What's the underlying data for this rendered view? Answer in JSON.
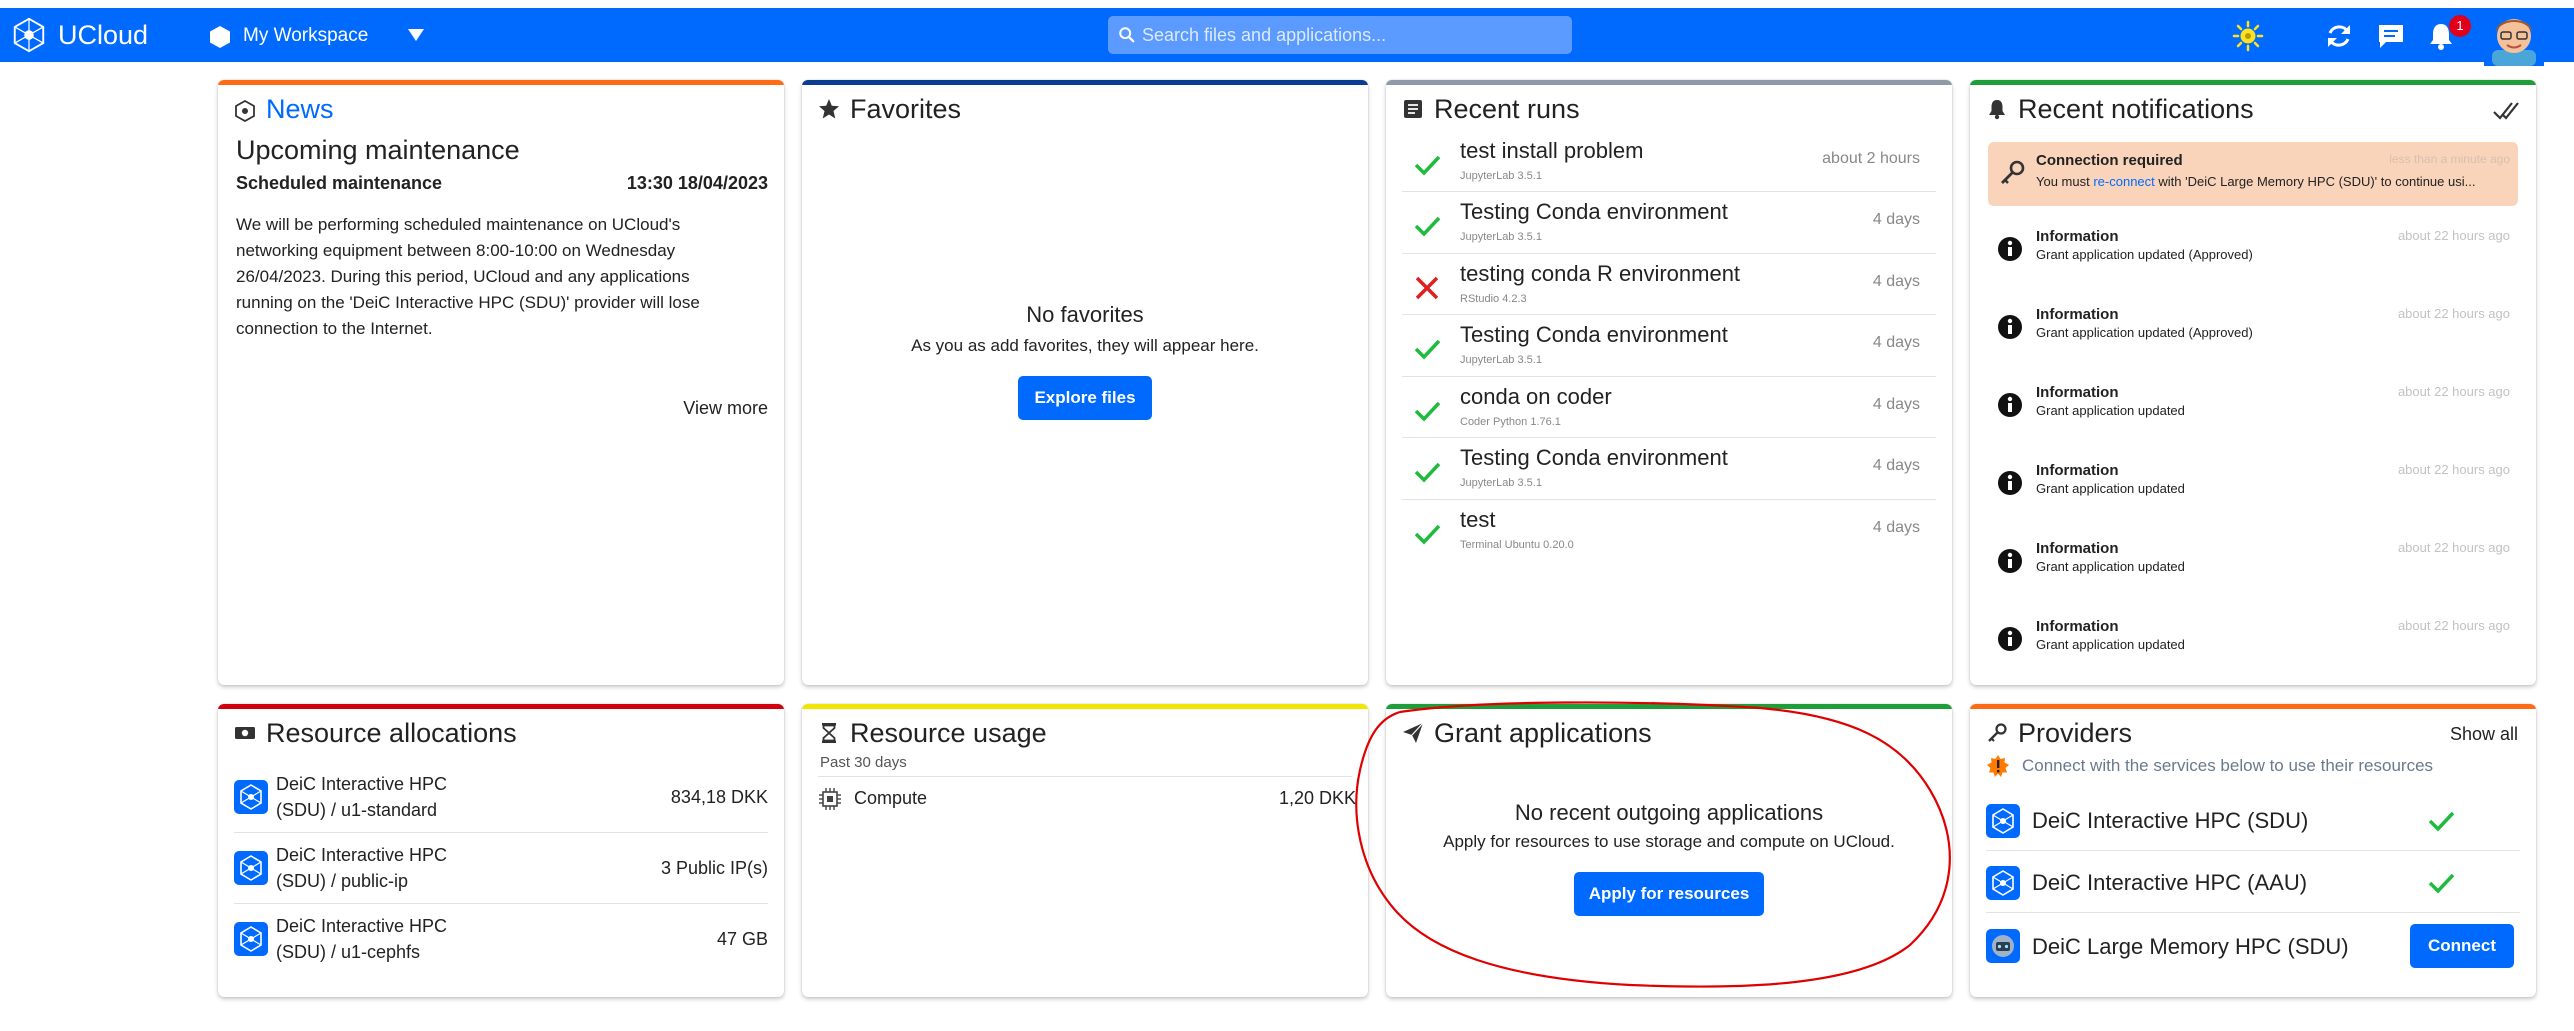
{
  "navbar": {
    "brand": "UCloud",
    "workspace": "My Workspace",
    "search_placeholder": "Search files and applications...",
    "notification_count": "1"
  },
  "news": {
    "title": "News",
    "headline": "Upcoming maintenance",
    "subheading": "Scheduled maintenance",
    "datetime": "13:30 18/04/2023",
    "body_lines": [
      "We will be performing scheduled maintenance on UCloud's",
      "networking equipment between 8:00-10:00 on Wednesday",
      "26/04/2023. During this period, UCloud and any applications",
      "running on the 'DeiC Interactive HPC (SDU)' provider will lose",
      "connection to the Internet."
    ],
    "view_more": "View more"
  },
  "favorites": {
    "title": "Favorites",
    "empty_title": "No favorites",
    "empty_text": "As you as add favorites, they will appear here.",
    "button": "Explore files"
  },
  "recent_runs": {
    "title": "Recent runs",
    "items": [
      {
        "name": "test install problem",
        "app": "JupyterLab 3.5.1",
        "time": "about 2 hours",
        "status": "success"
      },
      {
        "name": "Testing Conda environment",
        "app": "JupyterLab 3.5.1",
        "time": "4 days",
        "status": "success"
      },
      {
        "name": "testing conda R environment",
        "app": "RStudio 4.2.3",
        "time": "4 days",
        "status": "failure"
      },
      {
        "name": "Testing Conda environment",
        "app": "JupyterLab 3.5.1",
        "time": "4 days",
        "status": "success"
      },
      {
        "name": "conda on coder",
        "app": "Coder Python 1.76.1",
        "time": "4 days",
        "status": "success"
      },
      {
        "name": "Testing Conda environment",
        "app": "JupyterLab 3.5.1",
        "time": "4 days",
        "status": "success"
      },
      {
        "name": "test",
        "app": "Terminal Ubuntu 0.20.0",
        "time": "4 days",
        "status": "success"
      }
    ]
  },
  "recent_notifications": {
    "title": "Recent notifications",
    "connection": {
      "title": "Connection required",
      "time": "less than a minute ago",
      "text_before": "You must ",
      "link": "re-connect",
      "text_after": " with 'DeiC Large Memory HPC (SDU)' to continue usi..."
    },
    "items": [
      {
        "title": "Information",
        "text": "Grant application updated (Approved)",
        "time": "about 22 hours ago"
      },
      {
        "title": "Information",
        "text": "Grant application updated (Approved)",
        "time": "about 22 hours ago"
      },
      {
        "title": "Information",
        "text": "Grant application updated",
        "time": "about 22 hours ago"
      },
      {
        "title": "Information",
        "text": "Grant application updated",
        "time": "about 22 hours ago"
      },
      {
        "title": "Information",
        "text": "Grant application updated",
        "time": "about 22 hours ago"
      },
      {
        "title": "Information",
        "text": "Grant application updated",
        "time": "about 22 hours ago"
      }
    ]
  },
  "resource_allocations": {
    "title": "Resource allocations",
    "items": [
      {
        "line1": "DeiC Interactive HPC",
        "line2": "(SDU) / u1-standard",
        "value": "834,18 DKK"
      },
      {
        "line1": "DeiC Interactive HPC",
        "line2": "(SDU) / public-ip",
        "value": "3 Public IP(s)"
      },
      {
        "line1": "DeiC Interactive HPC",
        "line2": "(SDU) / u1-cephfs",
        "value": "47 GB"
      }
    ]
  },
  "resource_usage": {
    "title": "Resource usage",
    "period": "Past 30 days",
    "items": [
      {
        "label": "Compute",
        "value": "1,20 DKK"
      }
    ]
  },
  "grant_applications": {
    "title": "Grant applications",
    "empty_title": "No recent outgoing applications",
    "empty_text": "Apply for resources to use storage and compute on UCloud.",
    "button": "Apply for resources"
  },
  "providers": {
    "title": "Providers",
    "show_all": "Show all",
    "notice": "Connect with the services below to use their resources",
    "items": [
      {
        "name": "DeiC Interactive HPC (SDU)",
        "state": "connected"
      },
      {
        "name": "DeiC Interactive HPC (AAU)",
        "state": "connected"
      },
      {
        "name": "DeiC Large Memory HPC (SDU)",
        "state": "connect"
      }
    ],
    "connect_label": "Connect"
  },
  "colors": {
    "primary": "#006aff",
    "news_accent": "#ff6a14",
    "favorites_accent": "#0a3d91",
    "runs_accent": "#8e9aa7",
    "notifications_accent": "#1f9d3a",
    "allocations_accent": "#d2000f",
    "usage_accent": "#f2e600",
    "grants_accent": "#1f9d3a",
    "providers_accent": "#ff6a14",
    "success": "#1fbb3f",
    "error": "#e02020",
    "annotation": "#e00000"
  },
  "icons": [
    "ucloud-logo-icon",
    "workspace-icon",
    "caret-down-icon",
    "search-icon",
    "sun-icon",
    "refresh-icon",
    "chat-icon",
    "bell-icon",
    "star-icon",
    "runs-icon",
    "bell-icon",
    "check-double-icon",
    "key-icon",
    "info-icon",
    "money-icon",
    "hourglass-icon",
    "cpu-icon",
    "paper-plane-icon",
    "key-icon",
    "warning-icon",
    "provider-icon",
    "checkmark-icon",
    "cross-icon"
  ]
}
